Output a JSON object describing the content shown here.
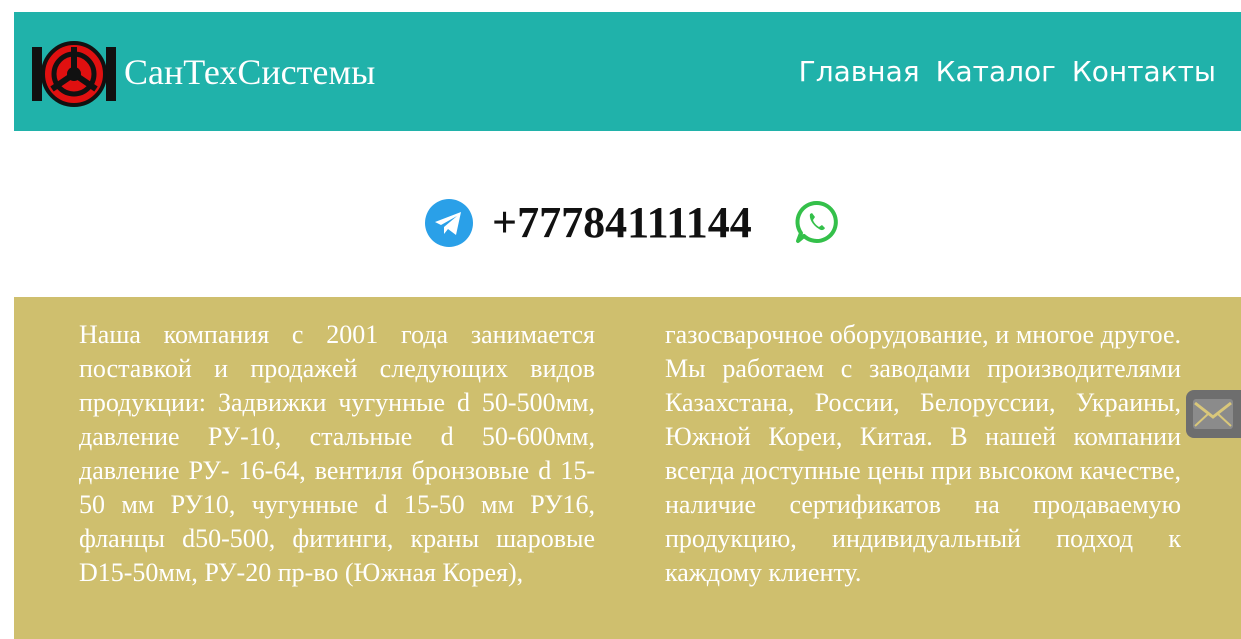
{
  "header": {
    "brand": "СанТехСистемы",
    "logo_icon": "valve-handwheel-icon",
    "nav": [
      {
        "label": "Главная"
      },
      {
        "label": "Каталог"
      },
      {
        "label": "Контакты"
      }
    ]
  },
  "contact": {
    "phone": "+77784111144",
    "telegram_icon": "telegram-icon",
    "whatsapp_icon": "whatsapp-icon"
  },
  "about": {
    "text_col1": "Наша компания с 2001 года занимается поставкой и продажей следующих видов продукции: Задвижки чугунные d 50-500мм, давление РУ-10, стальные d 50-600мм, давление РУ- 16-64, вентиля бронзовые d 15-50 мм РУ10, чугунные d 15-50 мм РУ16, фланцы d50-500, фитинги, краны шаровые D15-50мм, РУ-20 пр-во (Южная Корея),",
    "text_col2": "газосварочное оборудование, и многое другое. Мы работаем с заводами производителями Казахстана, России, Белоруссии, Украины, Южной Кореи, Китая. В нашей компании всегда доступные цены при высоком качестве, наличие сертификатов на продаваемую продукцию, индивидуальный подход к каждому клиенту."
  },
  "floating": {
    "mail_icon": "mail-icon"
  },
  "colors": {
    "header_bg": "#20b2aa",
    "about_bg": "#cfbf6e",
    "logo_red": "#e01010",
    "telegram_blue": "#2aa0e8",
    "whatsapp_green": "#34c04a"
  }
}
